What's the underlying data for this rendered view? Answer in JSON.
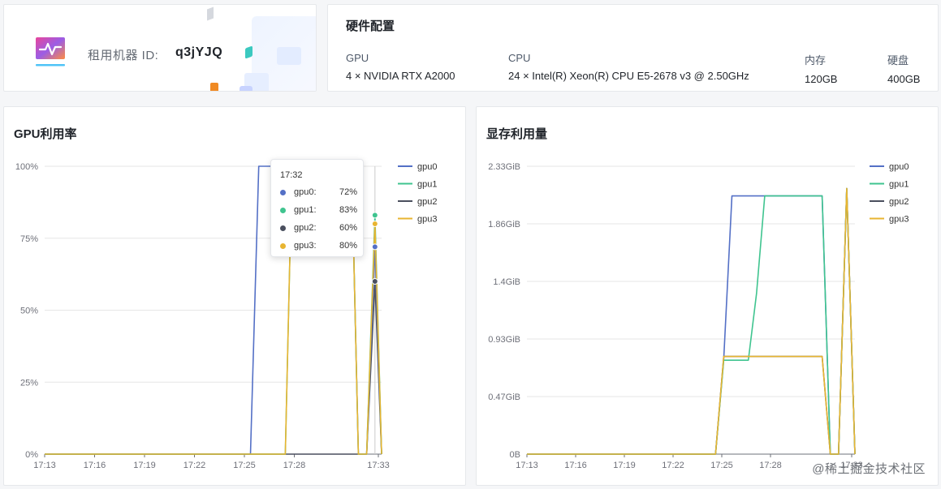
{
  "machine": {
    "label": "租用机器 ID:",
    "id": "q3jYJQ",
    "logo_icon": "activity-chart-icon"
  },
  "hardware": {
    "title": "硬件配置",
    "columns": [
      {
        "key": "GPU",
        "value": "4 × NVIDIA RTX A2000"
      },
      {
        "key": "CPU",
        "value": "24 × Intel(R) Xeon(R) CPU E5-2678 v3 @ 2.50GHz"
      },
      {
        "key": "内存",
        "value": "120GB"
      },
      {
        "key": "硬盘",
        "value": "400GB"
      }
    ]
  },
  "colors": {
    "gpu0": "#5470c6",
    "gpu1": "#3fc48f",
    "gpu2": "#4a4f5e",
    "gpu3": "#e8b531",
    "grid": "#e6e6e6"
  },
  "gpu_chart": {
    "title": "GPU利用率",
    "tooltip": {
      "time": "17:32",
      "rows": [
        {
          "name": "gpu0:",
          "value": "72%",
          "color": "#5470c6"
        },
        {
          "name": "gpu1:",
          "value": "83%",
          "color": "#3fc48f"
        },
        {
          "name": "gpu2:",
          "value": "60%",
          "color": "#4a4f5e"
        },
        {
          "name": "gpu3:",
          "value": "80%",
          "color": "#e8b531"
        }
      ]
    }
  },
  "mem_chart": {
    "title": "显存利用量"
  },
  "watermark": "@稀土掘金技术社区",
  "chart_data": [
    {
      "type": "line",
      "title": "GPU利用率",
      "x_ticks": [
        "17:13",
        "17:16",
        "17:19",
        "17:22",
        "17:25",
        "17:28",
        "17:33"
      ],
      "y_ticks": [
        "0%",
        "25%",
        "50%",
        "75%",
        "100%"
      ],
      "ylim": [
        0,
        100
      ],
      "xlim_minutes": [
        0,
        20.3
      ],
      "legend_position": "top-right",
      "grid": true,
      "series": [
        {
          "name": "gpu0",
          "points": [
            [
              0,
              0
            ],
            [
              12.4,
              0
            ],
            [
              12.9,
              100
            ],
            [
              18.5,
              100
            ],
            [
              18.9,
              0
            ],
            [
              19.4,
              0
            ],
            [
              19.9,
              72
            ],
            [
              20.3,
              0
            ]
          ]
        },
        {
          "name": "gpu1",
          "points": [
            [
              0,
              0
            ],
            [
              14.5,
              0
            ],
            [
              14.9,
              100
            ],
            [
              18.5,
              100
            ],
            [
              18.9,
              0
            ],
            [
              19.4,
              0
            ],
            [
              19.9,
              83
            ],
            [
              20.3,
              0
            ]
          ]
        },
        {
          "name": "gpu2",
          "points": [
            [
              0,
              0
            ],
            [
              19.4,
              0
            ],
            [
              19.9,
              60
            ],
            [
              20.3,
              0
            ]
          ]
        },
        {
          "name": "gpu3",
          "points": [
            [
              0,
              0
            ],
            [
              14.5,
              0
            ],
            [
              14.9,
              100
            ],
            [
              18.5,
              100
            ],
            [
              18.9,
              0
            ],
            [
              19.4,
              0
            ],
            [
              19.9,
              80
            ],
            [
              20.3,
              0
            ]
          ]
        }
      ]
    },
    {
      "type": "line",
      "title": "显存利用量",
      "x_ticks": [
        "17:13",
        "17:16",
        "17:19",
        "17:22",
        "17:25",
        "17:28",
        "17:33"
      ],
      "y_ticks": [
        "0B",
        "0.47GiB",
        "0.93GiB",
        "1.4GiB",
        "1.86GiB",
        "2.33GiB"
      ],
      "ylim": [
        0,
        2.33
      ],
      "xlim_minutes": [
        0,
        20.0
      ],
      "legend_position": "top-right",
      "grid": true,
      "series": [
        {
          "name": "gpu0",
          "points": [
            [
              0,
              0
            ],
            [
              11.5,
              0
            ],
            [
              12.0,
              0.77
            ],
            [
              12.5,
              2.09
            ],
            [
              18.0,
              2.09
            ],
            [
              18.5,
              0
            ],
            [
              19.0,
              0
            ],
            [
              19.5,
              2.15
            ],
            [
              20.0,
              0
            ]
          ]
        },
        {
          "name": "gpu1",
          "points": [
            [
              0,
              0
            ],
            [
              11.5,
              0
            ],
            [
              12.0,
              0.76
            ],
            [
              13.5,
              0.76
            ],
            [
              14.0,
              1.3
            ],
            [
              14.5,
              2.09
            ],
            [
              18.0,
              2.09
            ],
            [
              18.5,
              0
            ],
            [
              19.0,
              0
            ],
            [
              19.5,
              2.15
            ],
            [
              20.0,
              0
            ]
          ]
        },
        {
          "name": "gpu2",
          "points": [
            [
              0,
              0
            ],
            [
              11.5,
              0
            ],
            [
              12.0,
              0.79
            ],
            [
              18.0,
              0.79
            ],
            [
              18.5,
              0
            ],
            [
              19.0,
              0
            ],
            [
              19.5,
              2.15
            ],
            [
              20.0,
              0
            ]
          ]
        },
        {
          "name": "gpu3",
          "points": [
            [
              0,
              0
            ],
            [
              11.5,
              0
            ],
            [
              12.0,
              0.79
            ],
            [
              18.0,
              0.79
            ],
            [
              18.5,
              0
            ],
            [
              19.0,
              0
            ],
            [
              19.5,
              2.15
            ],
            [
              20.0,
              0
            ]
          ]
        }
      ]
    }
  ]
}
